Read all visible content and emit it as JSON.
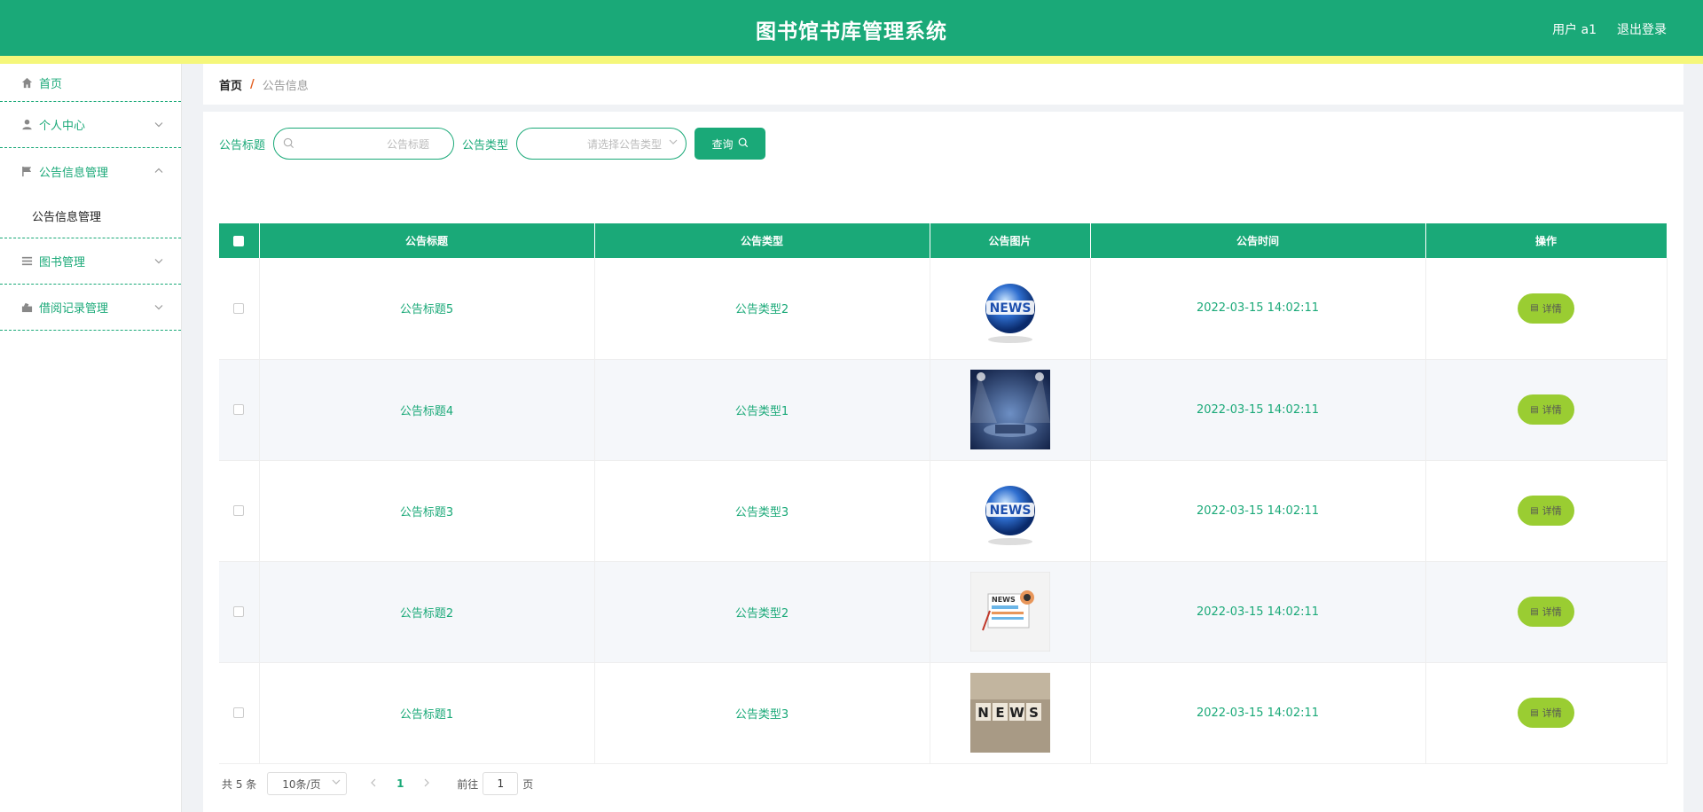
{
  "header": {
    "title": "图书馆书库管理系统",
    "user": "用户 a1",
    "logout": "退出登录",
    "colors": {
      "primary": "#1aa978",
      "strip": "#f5f77a",
      "accent_button": "#9acd32"
    }
  },
  "sidebar": {
    "items": [
      {
        "label": "首页",
        "icon": "home-icon"
      },
      {
        "label": "个人中心",
        "icon": "user-icon"
      },
      {
        "label": "公告信息管理",
        "icon": "flag-icon"
      },
      {
        "label": "公告信息管理",
        "icon": ""
      },
      {
        "label": "图书管理",
        "icon": "list-icon"
      },
      {
        "label": "借阅记录管理",
        "icon": "record-icon"
      }
    ]
  },
  "breadcrumb": {
    "home": "首页",
    "sep": "/",
    "current": "公告信息"
  },
  "search": {
    "title_label": "公告标题",
    "title_placeholder": "公告标题",
    "type_label": "公告类型",
    "type_placeholder": "请选择公告类型",
    "query_label": "查询"
  },
  "table": {
    "headers": [
      "公告标题",
      "公告类型",
      "公告图片",
      "公告时间",
      "操作"
    ],
    "rows": [
      {
        "title": "公告标题5",
        "type": "公告类型2",
        "image": "globe-news-image",
        "time": "2022-03-15 14:02:11",
        "action": "详情"
      },
      {
        "title": "公告标题4",
        "type": "公告类型1",
        "image": "stage-news-image",
        "time": "2022-03-15 14:02:11",
        "action": "详情"
      },
      {
        "title": "公告标题3",
        "type": "公告类型3",
        "image": "globe-news-image",
        "time": "2022-03-15 14:02:11",
        "action": "详情"
      },
      {
        "title": "公告标题2",
        "type": "公告类型2",
        "image": "newspaper-image",
        "time": "2022-03-15 14:02:11",
        "action": "详情"
      },
      {
        "title": "公告标题1",
        "type": "公告类型3",
        "image": "letters-news-image",
        "time": "2022-03-15 14:02:11",
        "action": "详情"
      }
    ]
  },
  "pagination": {
    "total": "共 5 条",
    "page_size": "10条/页",
    "current_page": "1",
    "goto_label": "前往",
    "goto_value": "1",
    "page_unit": "页"
  }
}
